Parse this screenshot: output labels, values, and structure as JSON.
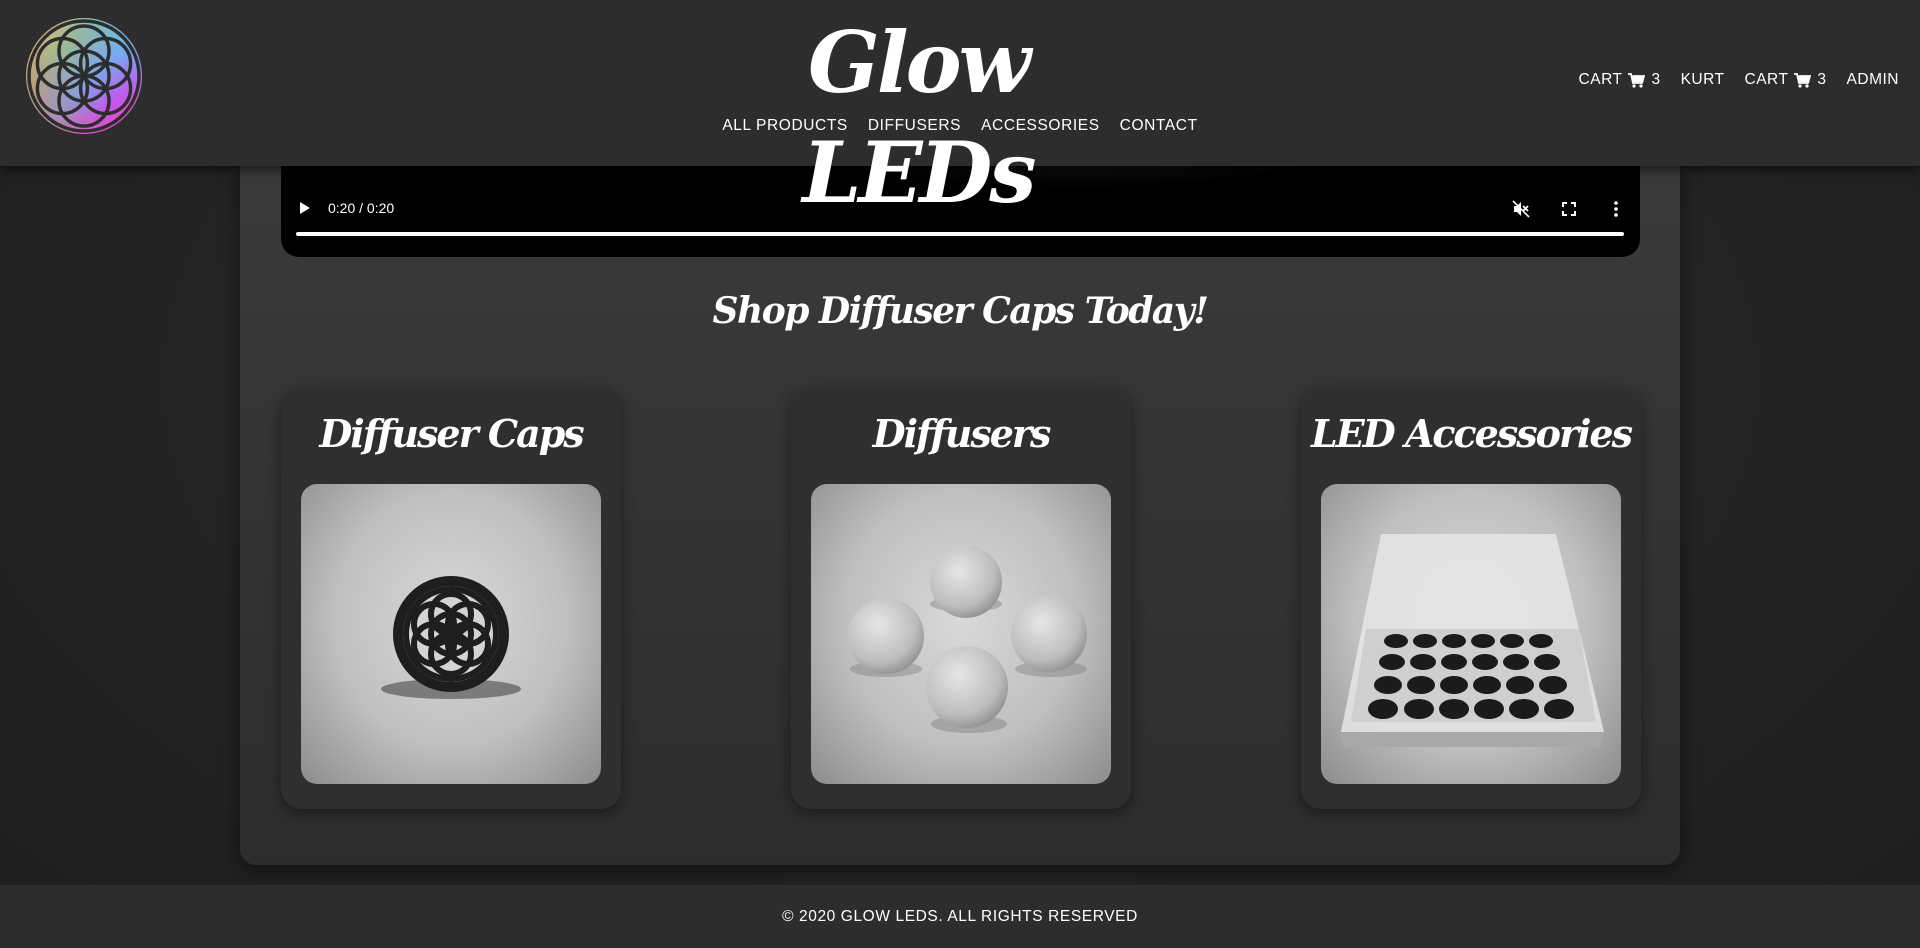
{
  "header": {
    "brand": "Glow LEDs",
    "nav": [
      "ALL PRODUCTS",
      "DIFFUSERS",
      "ACCESSORIES",
      "CONTACT"
    ],
    "right_nav": {
      "cart1_label": "CART",
      "cart1_count": "3",
      "user": "KURT",
      "cart2_label": "CART",
      "cart2_count": "3",
      "admin": "ADMIN"
    }
  },
  "video": {
    "time": "0:20 / 0:20",
    "progress": 1.0
  },
  "main": {
    "headline": "Shop Diffuser Caps Today!",
    "cards": [
      {
        "title": "Diffuser Caps"
      },
      {
        "title": "Diffusers"
      },
      {
        "title": "LED Accessories"
      }
    ]
  },
  "footer": {
    "text": "© 2020 GLOW LEDS. ALL RIGHTS RESERVED"
  }
}
